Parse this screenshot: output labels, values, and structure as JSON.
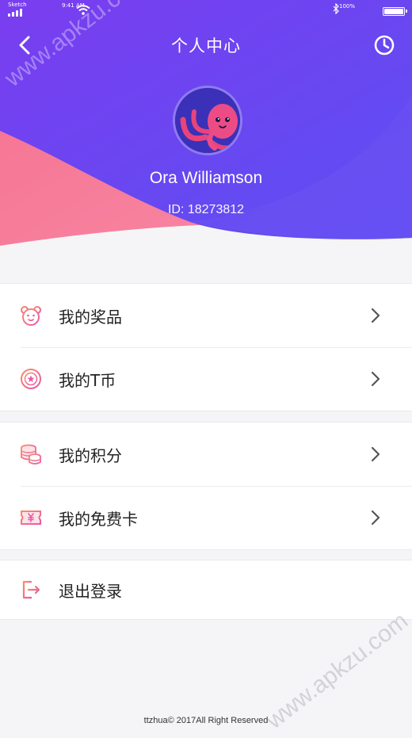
{
  "status_bar": {
    "carrier": "Sketch",
    "time": "9:41 AM",
    "battery_percent": "100%"
  },
  "nav": {
    "title": "个人中心",
    "back_icon": "chevron-left-icon",
    "history_icon": "clock-icon"
  },
  "profile": {
    "name": "Ora Williamson",
    "id_text": "ID: 18273812",
    "avatar_icon": "octopus-avatar"
  },
  "menu_groups": [
    {
      "items": [
        {
          "label": "我的奖品",
          "icon": "bear-icon"
        },
        {
          "label": "我的T币",
          "icon": "star-coin-icon"
        }
      ]
    },
    {
      "items": [
        {
          "label": "我的积分",
          "icon": "coin-stack-icon"
        },
        {
          "label": "我的免费卡",
          "icon": "ticket-icon"
        }
      ]
    },
    {
      "items": [
        {
          "label": "退出登录",
          "icon": "logout-icon"
        }
      ]
    }
  ],
  "footer": {
    "text": "ttzhua© 2017All Right Reserved"
  },
  "watermark": "www.apkzu.com",
  "colors": {
    "header_purple": "#6a45ef",
    "header_pink": "#f26a9a",
    "icon_gradient_start": "#f98a6b",
    "icon_gradient_end": "#e85aa8"
  }
}
